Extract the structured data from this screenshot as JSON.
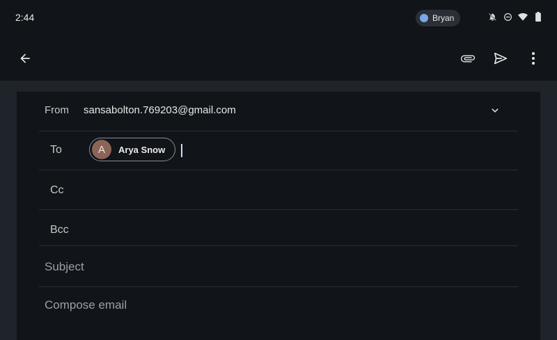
{
  "status_bar": {
    "time": "2:44",
    "user": "Bryan",
    "icons": [
      "notifications-off-icon",
      "do-not-disturb-icon",
      "wifi-icon",
      "battery-icon"
    ]
  },
  "app_bar": {
    "icons": [
      "back-arrow-icon",
      "attach-icon",
      "send-icon",
      "more-vert-icon"
    ]
  },
  "compose": {
    "from_label": "From",
    "from_value": "sansabolton.769203@gmail.com",
    "to_label": "To",
    "to_recipients": [
      {
        "initial": "A",
        "name": "Arya Snow"
      }
    ],
    "cc_label": "Cc",
    "bcc_label": "Bcc",
    "subject_placeholder": "Subject",
    "body_placeholder": "Compose email"
  },
  "colors": {
    "background": "#1f232a",
    "surface": "#111418",
    "chip_avatar": "#8b6457"
  }
}
